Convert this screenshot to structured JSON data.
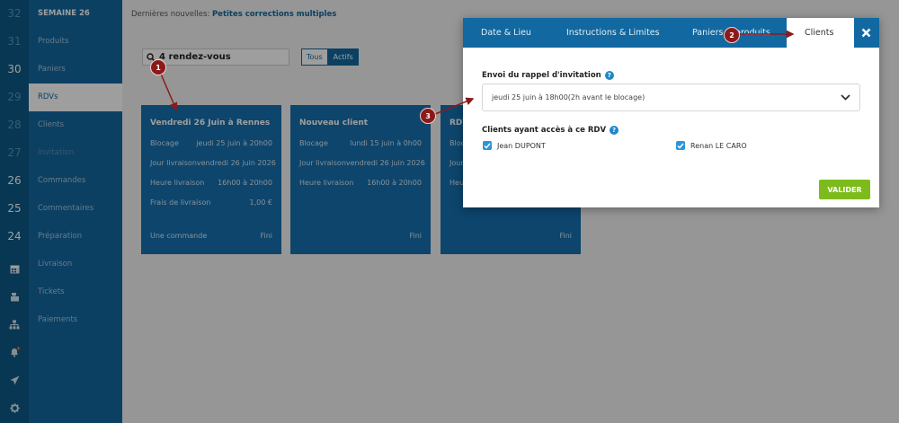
{
  "weeks": [
    "32",
    "31",
    "30",
    "29",
    "28",
    "27",
    "26",
    "25",
    "24"
  ],
  "highlight_weeks": [
    "30",
    "26",
    "25",
    "24"
  ],
  "sidebar": {
    "week_label": "SEMAINE 26",
    "items": [
      "Produits",
      "Paniers",
      "RDVs",
      "Clients",
      "Invitation",
      "Commandes",
      "Commentaires",
      "Préparation",
      "Livraison",
      "Tickets",
      "Paiements"
    ]
  },
  "icons": {
    "calendar": "calendar-icon",
    "register": "cash-register-icon",
    "sitemap": "sitemap-icon",
    "bell": "bell-icon",
    "send": "paper-plane-icon",
    "settings": "gear-icon"
  },
  "bell_badge": "1",
  "news": {
    "prefix": "Dernières nouvelles:",
    "text": "Petites corrections multiples"
  },
  "search": {
    "value": "4 rendez-vous"
  },
  "filter": {
    "all": "Tous",
    "active": "Actifs"
  },
  "cards": [
    {
      "title": "Vendredi 26 Juin à Rennes",
      "rows": [
        {
          "label": "Blocage",
          "value": "jeudi 25 juin à 20h00"
        },
        {
          "label": "Jour livraison",
          "value": "vendredi 26 juin 2026"
        },
        {
          "label": "Heure livraison",
          "value": "16h00 à 20h00"
        },
        {
          "label": "Frais de livraison",
          "value": "1,00 €"
        }
      ],
      "foot_left": "Une commande",
      "foot_right": "Fini"
    },
    {
      "title": "Nouveau client",
      "rows": [
        {
          "label": "Blocage",
          "value": "lundi 15 juin à 0h00"
        },
        {
          "label": "Jour livraison",
          "value": "vendredi 26 juin 2026"
        },
        {
          "label": "Heure livraison",
          "value": "16h00 à 20h00"
        }
      ],
      "foot_left": "",
      "foot_right": "Fini"
    },
    {
      "title": "RDV",
      "rows": [
        {
          "label": "Bloc",
          "value": ""
        },
        {
          "label": "Jour",
          "value": ""
        },
        {
          "label": "Heur",
          "value": ""
        }
      ],
      "foot_left": "",
      "foot_right": "Fini"
    }
  ],
  "modal": {
    "tabs": [
      "Date & Lieu",
      "Instructions & Limites",
      "Paniers & produits",
      "Clients"
    ],
    "active_tab": "Clients",
    "reminder_label": "Envoi du rappel d'invitation",
    "reminder_value": "jeudi 25 juin à 18h00(2h avant le blocage)",
    "clients_label": "Clients ayant accès à ce RDV",
    "clients": [
      "Jean DUPONT",
      "Renan LE CARO"
    ],
    "validate": "VALIDER"
  },
  "markers": [
    "1",
    "2",
    "3"
  ],
  "colors": {
    "sidebar": "#1268a0",
    "number_strip": "#0c5a86",
    "card": "#1670ae",
    "validate": "#7dbb1c",
    "marker": "#8b1a1a"
  }
}
